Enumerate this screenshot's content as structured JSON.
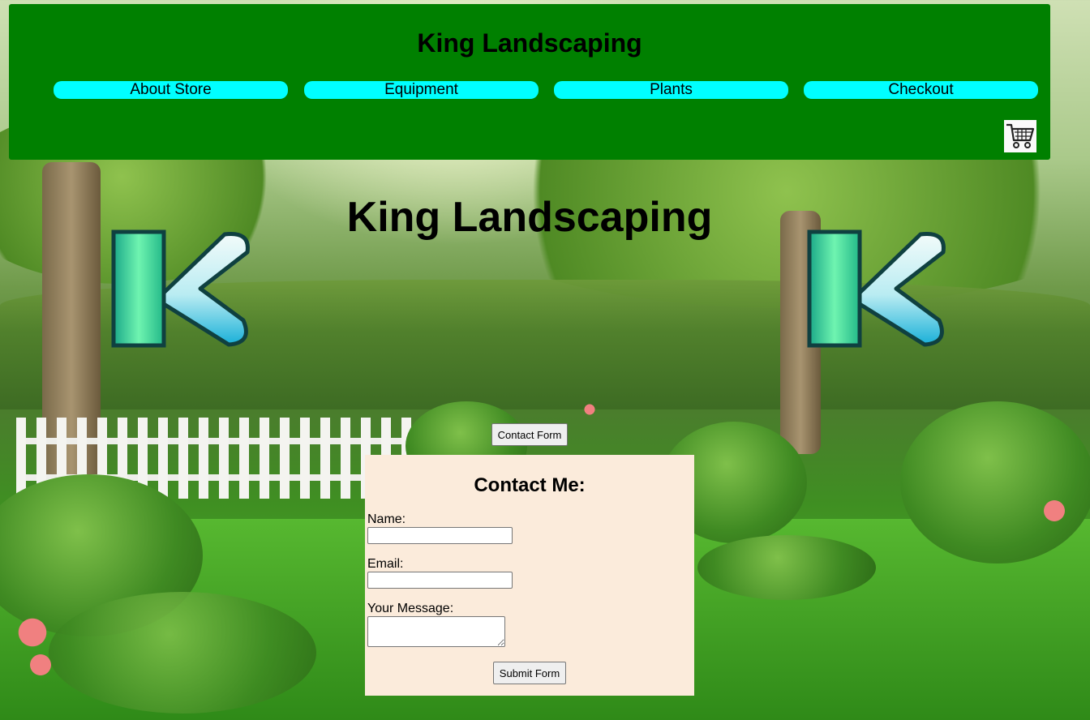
{
  "header": {
    "title": "King Landscaping",
    "background_color": "#008000",
    "nav": [
      {
        "label": "About Store"
      },
      {
        "label": "Equipment"
      },
      {
        "label": "Plants"
      },
      {
        "label": "Checkout"
      }
    ],
    "nav_color": "#00ffff",
    "cart_icon": "shopping-cart-icon"
  },
  "hero": {
    "title": "King Landscaping",
    "logo_icon": "k-logo-icon"
  },
  "contact_toggle_label": "Contact Form",
  "contact_form": {
    "heading": "Contact Me:",
    "background_color": "#fbebdb",
    "name_label": "Name:",
    "name_value": "",
    "email_label": "Email:",
    "email_value": "",
    "message_label": "Your Message:",
    "message_value": "",
    "submit_label": "Submit Form"
  }
}
